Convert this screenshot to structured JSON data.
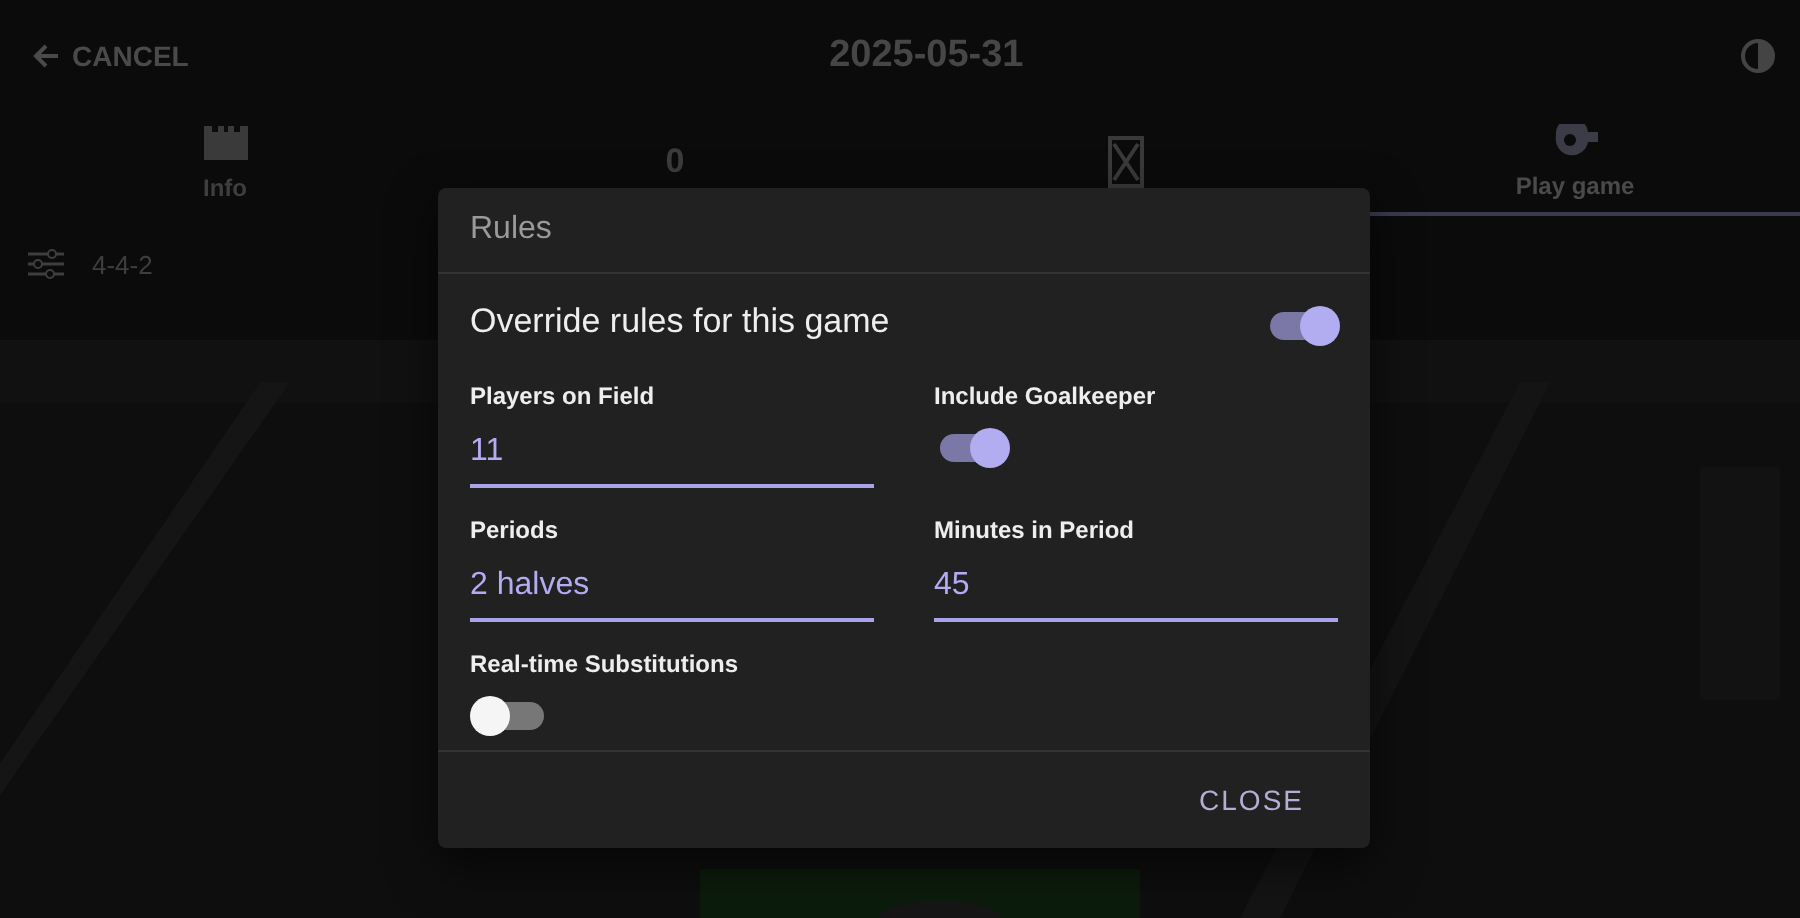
{
  "header": {
    "cancel": "CANCEL",
    "date": "2025-05-31"
  },
  "tabs": [
    {
      "kind": "icon",
      "label": "Info",
      "selected": false
    },
    {
      "kind": "count",
      "count": "0",
      "selected": false
    },
    {
      "kind": "icon",
      "selected": false
    },
    {
      "kind": "icon",
      "label": "Play game",
      "selected": true
    }
  ],
  "formation": "4-4-2",
  "dialog": {
    "title": "Rules",
    "override": {
      "label": "Override rules for this game",
      "on": true
    },
    "fields": [
      {
        "kind": "text",
        "label": "Players on Field",
        "value": "11"
      },
      {
        "kind": "switch",
        "label": "Include Goalkeeper",
        "on": true
      },
      {
        "kind": "text",
        "label": "Periods",
        "value": "2 halves"
      },
      {
        "kind": "text",
        "label": "Minutes in Period",
        "value": "45"
      },
      {
        "kind": "switch",
        "label": "Real-time Substitutions",
        "on": false
      }
    ],
    "close": "CLOSE"
  }
}
